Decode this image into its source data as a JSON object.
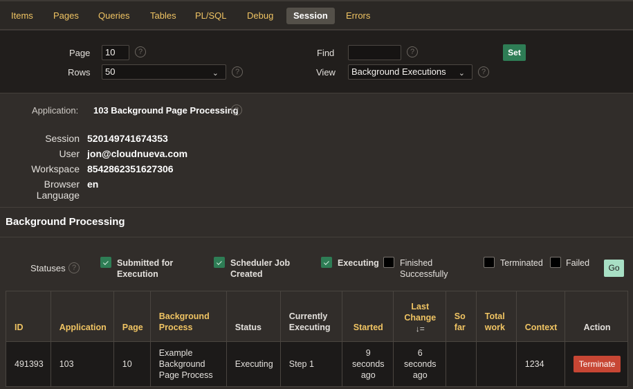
{
  "tabs": [
    {
      "label": "Items",
      "active": false
    },
    {
      "label": "Pages",
      "active": false
    },
    {
      "label": "Queries",
      "active": false
    },
    {
      "label": "Tables",
      "active": false
    },
    {
      "label": "PL/SQL",
      "active": false
    },
    {
      "label": "Debug",
      "active": false
    },
    {
      "label": "Session",
      "active": true
    },
    {
      "label": "Errors",
      "active": false
    }
  ],
  "filters": {
    "page_label": "Page",
    "page_value": "10",
    "rows_label": "Rows",
    "rows_value": "50",
    "find_label": "Find",
    "find_value": "",
    "view_label": "View",
    "view_value": "Background Executions",
    "set_label": "Set",
    "help_glyph": "?"
  },
  "info": {
    "application_label": "Application:",
    "application_value": "103 Background Page Processing",
    "session_label": "Session",
    "session_value": "520149741674353",
    "user_label": "User",
    "user_value": "jon@cloudnueva.com",
    "workspace_label": "Workspace",
    "workspace_value": "8542862351627306",
    "language_label": "Browser Language",
    "language_value": "en"
  },
  "background": {
    "title": "Background Processing",
    "statuses_label": "Statuses",
    "statuses": [
      {
        "line1": "Submitted for",
        "line2": "Execution",
        "checked": true
      },
      {
        "line1": "Scheduler Job",
        "line2": "Created",
        "checked": true
      },
      {
        "line1": "Executing",
        "line2": "",
        "checked": true
      },
      {
        "line1": "Finished",
        "line2": "Successfully",
        "checked": false
      },
      {
        "line1": "Terminated",
        "line2": "",
        "checked": false
      },
      {
        "line1": "Failed",
        "line2": "",
        "checked": false
      }
    ],
    "go_label": "Go"
  },
  "table": {
    "columns": [
      {
        "l1": "ID",
        "l2": "",
        "sortable": true
      },
      {
        "l1": "Application",
        "l2": "",
        "sortable": true
      },
      {
        "l1": "Page",
        "l2": "",
        "sortable": true
      },
      {
        "l1": "Background",
        "l2": "Process",
        "sortable": true
      },
      {
        "l1": "Status",
        "l2": "",
        "sortable": false
      },
      {
        "l1": "Currently",
        "l2": "Executing",
        "sortable": false
      },
      {
        "l1": "Started",
        "l2": "",
        "sortable": true
      },
      {
        "l1": "Last",
        "l2": "Change",
        "sortable": true,
        "sort_indicator": "↓="
      },
      {
        "l1": "So",
        "l2": "far",
        "sortable": true
      },
      {
        "l1": "Total",
        "l2": "work",
        "sortable": true
      },
      {
        "l1": "Context",
        "l2": "",
        "sortable": true
      },
      {
        "l1": "Action",
        "l2": "",
        "sortable": false
      }
    ],
    "rows": [
      {
        "id": "491393",
        "application": "103",
        "page": "10",
        "process_l1": "Example",
        "process_l2": "Background",
        "process_l3": "Page Process",
        "status": "Executing",
        "current": "Step 1",
        "started_l1": "9",
        "started_l2": "seconds",
        "started_l3": "ago",
        "last_l1": "6",
        "last_l2": "seconds",
        "last_l3": "ago",
        "so_far": "",
        "total_work": "",
        "context": "1234",
        "action": "Terminate"
      }
    ]
  }
}
